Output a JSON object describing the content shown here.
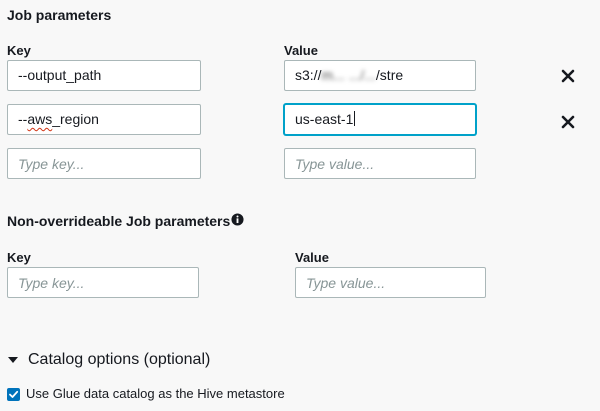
{
  "job_parameters": {
    "title": "Job parameters",
    "key_header": "Key",
    "value_header": "Value",
    "rows": [
      {
        "key": "--output_path",
        "value_prefix": "s3://",
        "value_obscured": "m... .../...",
        "value_suffix": "/stre"
      },
      {
        "key_prefix": "--",
        "key_spellcheck_word": "aws",
        "key_suffix": "_region",
        "value": "us-east-1"
      }
    ],
    "new_key_placeholder": "Type key...",
    "new_value_placeholder": "Type value..."
  },
  "non_overrideable": {
    "title": "Non-overrideable Job parameters",
    "key_header": "Key",
    "value_header": "Value",
    "key_placeholder": "Type key...",
    "value_placeholder": "Type value..."
  },
  "catalog_options": {
    "title": "Catalog options (optional)",
    "expanded": true,
    "checkbox_label": "Use Glue data catalog as the Hive metastore",
    "checked": true
  },
  "icons": {
    "remove": "close-x-icon",
    "info": "info-circle-icon",
    "caret": "caret-down-icon",
    "check": "checkmark-icon"
  },
  "colors": {
    "focus": "#00a1c9",
    "checkbox": "#0073bb",
    "placeholder": "#879596"
  }
}
